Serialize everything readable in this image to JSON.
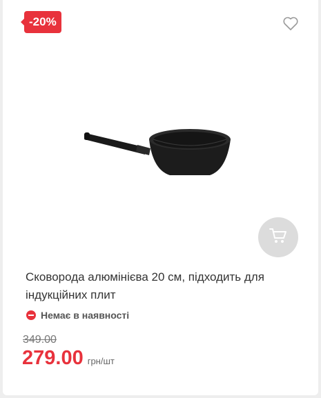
{
  "product": {
    "discount_badge": "-20%",
    "title": "Сковорода алюмінієва 20 см, підходить для індукційних плит",
    "availability": "Немає в наявності",
    "old_price": "349.00",
    "price": "279.00",
    "price_unit": "грн/шт",
    "icons": {
      "favorite": "heart-outline-icon",
      "cart": "shopping-cart-icon",
      "status": "minus-circle-icon"
    }
  },
  "colors": {
    "accent": "#e8323c",
    "cart_button_bg": "#dcdcdc",
    "text": "#333333"
  }
}
